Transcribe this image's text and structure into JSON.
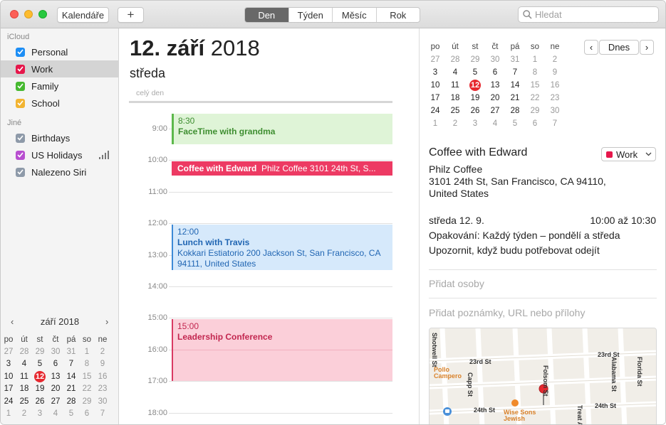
{
  "toolbar": {
    "calendars_label": "Kalendáře",
    "add_label": "+",
    "views": [
      {
        "label": "Den",
        "active": true
      },
      {
        "label": "Týden",
        "active": false
      },
      {
        "label": "Měsíc",
        "active": false
      },
      {
        "label": "Rok",
        "active": false
      }
    ],
    "search_placeholder": "Hledat"
  },
  "sidebar": {
    "groups": [
      {
        "title": "iCloud",
        "calendars": [
          {
            "name": "Personal",
            "color": "#1d8ef5",
            "checked": true,
            "selected": false
          },
          {
            "name": "Work",
            "color": "#e6174b",
            "checked": true,
            "selected": true
          },
          {
            "name": "Family",
            "color": "#46b930",
            "checked": true,
            "selected": false
          },
          {
            "name": "School",
            "color": "#f2b431",
            "checked": true,
            "selected": false
          }
        ]
      },
      {
        "title": "Jiné",
        "calendars": [
          {
            "name": "Birthdays",
            "color": "#8e9aa9",
            "checked": true,
            "selected": false
          },
          {
            "name": "US Holidays",
            "color": "#b84fd0",
            "checked": true,
            "selected": false,
            "subscribed": true
          },
          {
            "name": "Nalezeno Siri",
            "color": "#8e9aa9",
            "checked": true,
            "selected": false
          }
        ]
      }
    ],
    "mini_calendar": {
      "title": "září 2018",
      "weekdays": [
        "po",
        "út",
        "st",
        "čt",
        "pá",
        "so",
        "ne"
      ],
      "weeks": [
        [
          "27",
          "28",
          "29",
          "30",
          "31",
          "1",
          "2"
        ],
        [
          "3",
          "4",
          "5",
          "6",
          "7",
          "8",
          "9"
        ],
        [
          "10",
          "11",
          "12",
          "13",
          "14",
          "15",
          "16"
        ],
        [
          "17",
          "18",
          "19",
          "20",
          "21",
          "22",
          "23"
        ],
        [
          "24",
          "25",
          "26",
          "27",
          "28",
          "29",
          "30"
        ],
        [
          "1",
          "2",
          "3",
          "4",
          "5",
          "6",
          "7"
        ]
      ],
      "today": "12"
    }
  },
  "day": {
    "date_bold": "12. září",
    "date_year": "2018",
    "weekday": "středa",
    "all_day_label": "celý den",
    "hours": [
      "9:00",
      "10:00",
      "11:00",
      "12:00",
      "13:00",
      "14:00",
      "15:00",
      "16:00",
      "17:00",
      "18:00"
    ],
    "events": [
      {
        "time": "8:30",
        "title": "FaceTime with grandma",
        "location": "",
        "style": "green"
      },
      {
        "time": "",
        "title": "Coffee with Edward",
        "location": "Philz Coffee 3101 24th St, S...",
        "style": "red"
      },
      {
        "time": "12:00",
        "title": "Lunch with Travis",
        "location": "Kokkari Estiatorio 200 Jackson St, San Francisco, CA  94111, United States",
        "style": "blue"
      },
      {
        "time": "15:00",
        "title": "Leadership Conference",
        "location": "",
        "style": "pink"
      }
    ]
  },
  "inspector": {
    "calendar": {
      "weekdays": [
        "po",
        "út",
        "st",
        "čt",
        "pá",
        "so",
        "ne"
      ],
      "weeks": [
        [
          "27",
          "28",
          "29",
          "30",
          "31",
          "1",
          "2"
        ],
        [
          "3",
          "4",
          "5",
          "6",
          "7",
          "8",
          "9"
        ],
        [
          "10",
          "11",
          "12",
          "13",
          "14",
          "15",
          "16"
        ],
        [
          "17",
          "18",
          "19",
          "20",
          "21",
          "22",
          "23"
        ],
        [
          "24",
          "25",
          "26",
          "27",
          "28",
          "29",
          "30"
        ],
        [
          "1",
          "2",
          "3",
          "4",
          "5",
          "6",
          "7"
        ]
      ],
      "today": "12",
      "today_button": "Dnes"
    },
    "event": {
      "title": "Coffee with Edward",
      "calendar_name": "Work",
      "calendar_color": "#e6174b",
      "location_name": "Philz Coffee",
      "address_line1": "3101 24th St, San Francisco, CA  94110,",
      "address_line2": "United States",
      "date": "středa 12. 9.",
      "time_range": "10:00 až 10:30",
      "repeat": "Opakování: Každý týden – pondělí a středa",
      "alert": "Upozornit, když budu potřebovat odejít",
      "add_people": "Přidat osoby",
      "add_notes": "Přidat poznámky, URL nebo přílohy"
    },
    "map": {
      "labels": [
        "23rd St",
        "23rd St",
        "24th St",
        "24th St",
        "Capp St",
        "Folsom St",
        "Treat Ave",
        "Alabama St",
        "Florida St",
        "Shotwell St",
        "Pollo Campero",
        "Wise Sons Jewish"
      ]
    }
  }
}
